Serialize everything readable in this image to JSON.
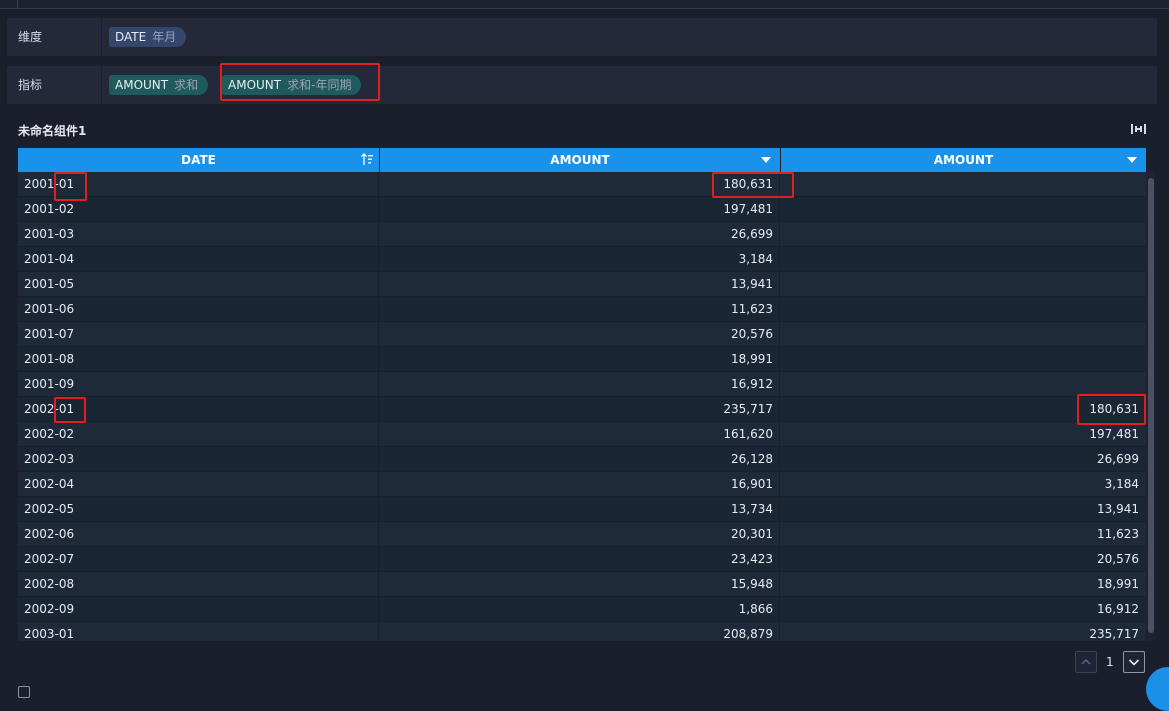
{
  "dimension_row": {
    "label": "维度",
    "pills": [
      {
        "field": "DATE",
        "agg": "年月"
      }
    ]
  },
  "measure_row": {
    "label": "指标",
    "pills": [
      {
        "field": "AMOUNT",
        "agg": "求和"
      },
      {
        "field": "AMOUNT",
        "agg": "求和-年同期"
      }
    ]
  },
  "widget": {
    "title": "未命名组件1"
  },
  "table": {
    "columns": [
      "DATE",
      "AMOUNT",
      "AMOUNT"
    ],
    "rows": [
      {
        "date": "2001-01",
        "amount": "180,631",
        "amount_yoy": ""
      },
      {
        "date": "2001-02",
        "amount": "197,481",
        "amount_yoy": ""
      },
      {
        "date": "2001-03",
        "amount": "26,699",
        "amount_yoy": ""
      },
      {
        "date": "2001-04",
        "amount": "3,184",
        "amount_yoy": ""
      },
      {
        "date": "2001-05",
        "amount": "13,941",
        "amount_yoy": ""
      },
      {
        "date": "2001-06",
        "amount": "11,623",
        "amount_yoy": ""
      },
      {
        "date": "2001-07",
        "amount": "20,576",
        "amount_yoy": ""
      },
      {
        "date": "2001-08",
        "amount": "18,991",
        "amount_yoy": ""
      },
      {
        "date": "2001-09",
        "amount": "16,912",
        "amount_yoy": ""
      },
      {
        "date": "2002-01",
        "amount": "235,717",
        "amount_yoy": "180,631"
      },
      {
        "date": "2002-02",
        "amount": "161,620",
        "amount_yoy": "197,481"
      },
      {
        "date": "2002-03",
        "amount": "26,128",
        "amount_yoy": "26,699"
      },
      {
        "date": "2002-04",
        "amount": "16,901",
        "amount_yoy": "3,184"
      },
      {
        "date": "2002-05",
        "amount": "13,734",
        "amount_yoy": "13,941"
      },
      {
        "date": "2002-06",
        "amount": "20,301",
        "amount_yoy": "11,623"
      },
      {
        "date": "2002-07",
        "amount": "23,423",
        "amount_yoy": "20,576"
      },
      {
        "date": "2002-08",
        "amount": "15,948",
        "amount_yoy": "18,991"
      },
      {
        "date": "2002-09",
        "amount": "1,866",
        "amount_yoy": "16,912"
      },
      {
        "date": "2003-01",
        "amount": "208,879",
        "amount_yoy": "235,717"
      }
    ]
  },
  "pager": {
    "page": "1"
  },
  "colors": {
    "background": "#1b1e2b",
    "header": "#1892ea",
    "highlight": "#e01f1f",
    "dimension_pill": "#34466b",
    "measure_pill": "#1e5a5e"
  }
}
